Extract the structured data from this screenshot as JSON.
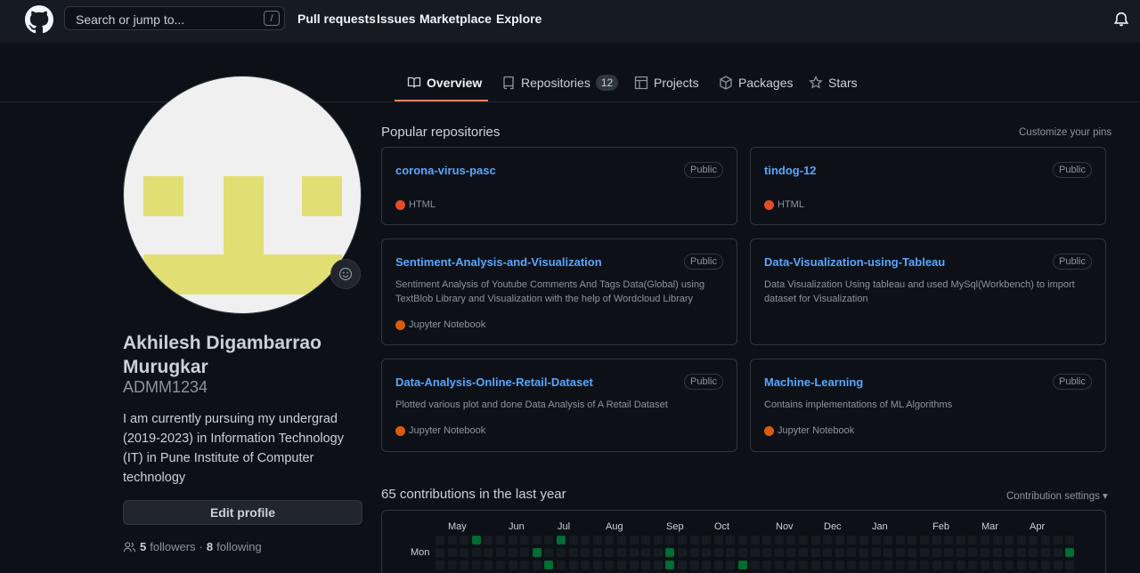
{
  "header": {
    "search_placeholder": "Search or jump to...",
    "search_key": "/",
    "nav": [
      "Pull requests",
      "Issues",
      "Marketplace",
      "Explore"
    ]
  },
  "tabs": [
    {
      "label": "Overview",
      "icon": "book-icon",
      "active": true
    },
    {
      "label": "Repositories",
      "icon": "repo-icon",
      "count": "12"
    },
    {
      "label": "Projects",
      "icon": "table-icon"
    },
    {
      "label": "Packages",
      "icon": "package-icon"
    },
    {
      "label": "Stars",
      "icon": "star-icon"
    }
  ],
  "profile": {
    "name": "Akhilesh Digambarrao Murugkar",
    "login": "ADMM1234",
    "bio": "I am currently pursuing my undergrad (2019-2023) in Information Technology (IT) in Pune Institute of Computer technology",
    "edit_label": "Edit profile",
    "followers": "5",
    "followers_label": "followers",
    "following": "8",
    "following_label": "following",
    "separator": "·"
  },
  "popular": {
    "title": "Popular repositories",
    "customize": "Customize your pins",
    "repos": [
      {
        "name": "corona-virus-pasc",
        "visibility": "Public",
        "description": "",
        "language": "HTML",
        "color": "#e34c26"
      },
      {
        "name": "tindog-12",
        "visibility": "Public",
        "description": "",
        "language": "HTML",
        "color": "#e34c26"
      },
      {
        "name": "Sentiment-Analysis-and-Visualization",
        "visibility": "Public",
        "description": "Sentiment Analysis of Youtube Comments And Tags Data(Global) using TextBlob Library and Visualization with the help of Wordcloud Library",
        "language": "Jupyter Notebook",
        "color": "#da5b0b"
      },
      {
        "name": "Data-Visualization-using-Tableau",
        "visibility": "Public",
        "description": "Data Visualization Using tableau and used MySql(Workbench) to import dataset for Visualization",
        "language": "",
        "color": ""
      },
      {
        "name": "Data-Analysis-Online-Retail-Dataset",
        "visibility": "Public",
        "description": "Plotted various plot and done Data Analysis of A Retail Dataset",
        "language": "Jupyter Notebook",
        "color": "#da5b0b"
      },
      {
        "name": "Machine-Learning",
        "visibility": "Public",
        "description": "Contains implementations of ML Algorithms",
        "language": "Jupyter Notebook",
        "color": "#da5b0b"
      }
    ]
  },
  "contributions": {
    "title": "65 contributions in the last year",
    "settings": "Contribution settings ▾",
    "months": [
      "May",
      "Jun",
      "Jul",
      "Aug",
      "Sep",
      "Oct",
      "Nov",
      "Dec",
      "Jan",
      "Feb",
      "Mar",
      "Apr"
    ],
    "day_label": "Mon"
  },
  "colors": {
    "accent": "#f78166",
    "link": "#58a6ff",
    "contribution": "#26a641"
  }
}
